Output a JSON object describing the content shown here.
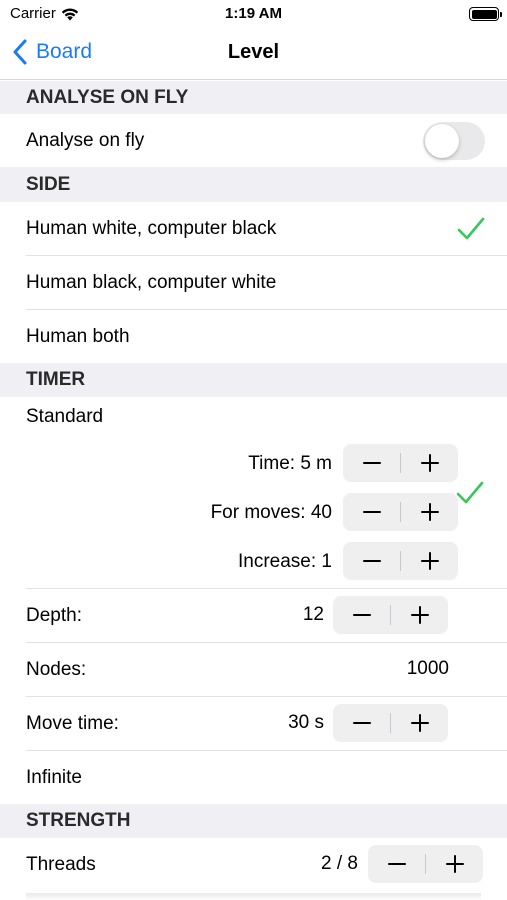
{
  "status_bar": {
    "carrier": "Carrier",
    "time": "1:19 AM",
    "wifi_icon": "wifi-icon",
    "battery_icon": "battery-icon"
  },
  "nav": {
    "back_label": "Board",
    "title": "Level"
  },
  "analyse": {
    "header": "ANALYSE ON FLY",
    "toggle_label": "Analyse on fly",
    "toggle_on": false
  },
  "side": {
    "header": "SIDE",
    "options": [
      {
        "label": "Human white, computer black",
        "selected": true
      },
      {
        "label": "Human black, computer white",
        "selected": false
      },
      {
        "label": "Human both",
        "selected": false
      }
    ]
  },
  "timer": {
    "header": "TIMER",
    "standard_label": "Standard",
    "standard_selected": true,
    "time": "Time: 5 m",
    "for_moves": "For moves: 40",
    "increase": "Increase: 1",
    "depth_label": "Depth:",
    "depth_value": "12",
    "nodes_label": "Nodes:",
    "nodes_value": "1000",
    "move_time_label": "Move time:",
    "move_time_value": "30 s",
    "infinite_label": "Infinite"
  },
  "strength": {
    "header": "STRENGTH",
    "threads_label": "Threads",
    "threads_value": "2 / 8"
  },
  "colors": {
    "accent": "#1a7cf5",
    "check": "#34c759",
    "section_bg": "#efeff4"
  }
}
